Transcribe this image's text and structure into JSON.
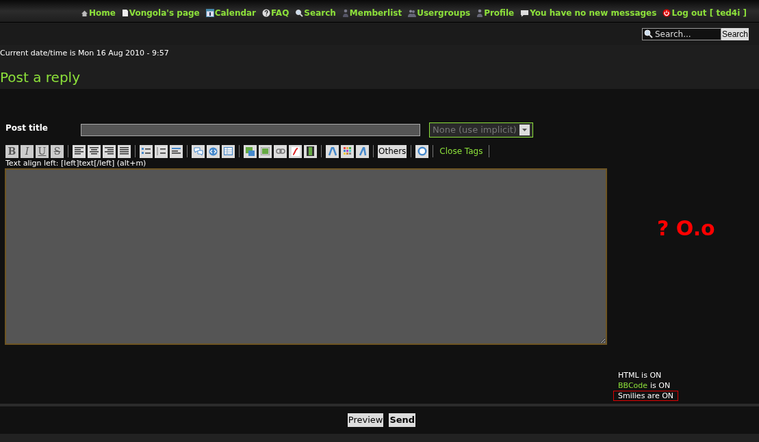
{
  "nav": [
    {
      "kind": "home",
      "label": "Home"
    },
    {
      "kind": "page",
      "label": "Vongola's page"
    },
    {
      "kind": "calendar",
      "label": "Calendar"
    },
    {
      "kind": "faq",
      "label": "FAQ"
    },
    {
      "kind": "search",
      "label": "Search"
    },
    {
      "kind": "members",
      "label": "Memberlist"
    },
    {
      "kind": "groups",
      "label": "Usergroups"
    },
    {
      "kind": "profile",
      "label": "Profile"
    },
    {
      "kind": "messages",
      "label": "You have no new messages"
    },
    {
      "kind": "logout",
      "label": "Log out [ ted4i ]"
    }
  ],
  "search": {
    "placeholder": "Search...",
    "button": "Search"
  },
  "datetime": "Current date/time is Mon 16 Aug 2010 - 9:57",
  "heading": "Post a reply",
  "post_title": {
    "label": "Post title",
    "select": "None (use implicit)"
  },
  "toolbar": {
    "format_buttons": [
      "B",
      "I",
      "U",
      "S"
    ],
    "others": "Others",
    "close_tags": "Close Tags"
  },
  "hint": "Text align left: [left]text[/left] (alt+m)",
  "side_text": "? O.o",
  "status": [
    {
      "text": "HTML is ON",
      "boxed": false
    },
    {
      "link": "BBCode",
      "text": "is ON",
      "boxed": false
    },
    {
      "text": "Smilies are ON",
      "boxed": true
    }
  ],
  "buttons": [
    {
      "label": "Preview",
      "primary": false
    },
    {
      "label": "Send",
      "primary": true
    }
  ]
}
